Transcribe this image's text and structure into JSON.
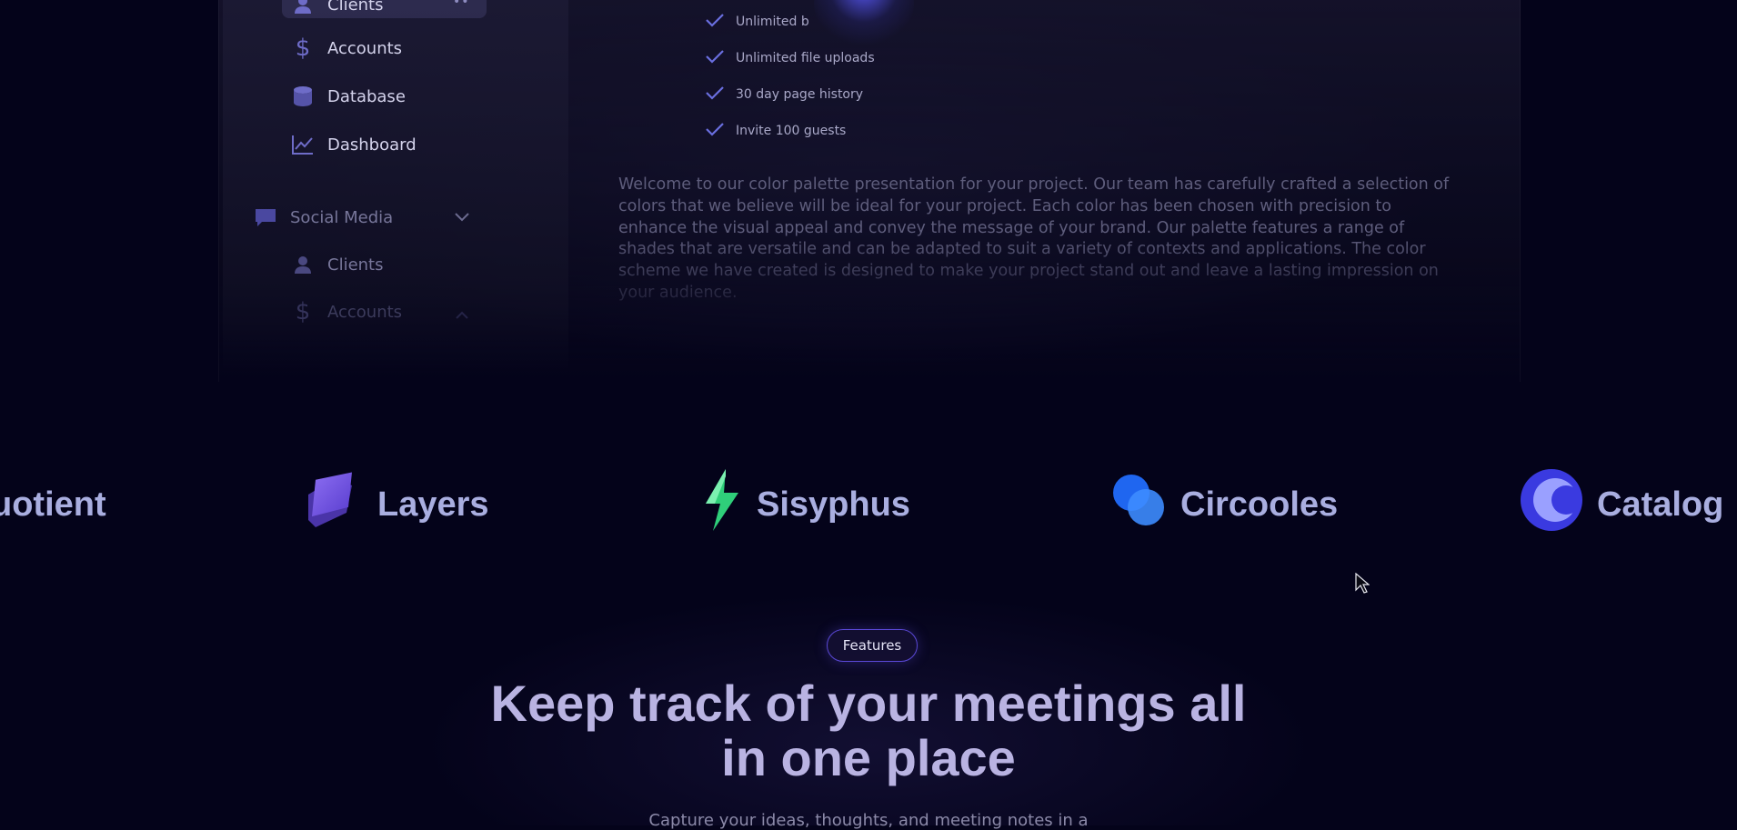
{
  "sidebar": {
    "items": [
      {
        "label": "Clients",
        "icon": "user-icon"
      },
      {
        "label": "Accounts",
        "icon": "dollar-icon"
      },
      {
        "label": "Database",
        "icon": "database-icon"
      },
      {
        "label": "Dashboard",
        "icon": "chart-line-icon"
      }
    ],
    "section": {
      "label": "Social Media",
      "icon": "chat-icon"
    },
    "sub_items": [
      {
        "label": "Clients",
        "icon": "user-icon"
      },
      {
        "label": "Accounts",
        "icon": "dollar-icon"
      }
    ]
  },
  "pricing": {
    "features": [
      "Unlimited b",
      "Unlimited file uploads",
      "30 day page history",
      "Invite 100 guests"
    ]
  },
  "description": "Welcome to our color palette presentation for your project. Our team has carefully crafted a selection of colors that we believe will be ideal for your project. Each color has been chosen with precision to enhance the visual appeal and convey the message of your brand. Our palette features a range of shades that are versatile and can be adapted to suit a variety of contexts and applications. The color scheme we have created is designed to make your project stand out and leave a lasting impression on your audience.",
  "logos": [
    {
      "name": "uotient"
    },
    {
      "name": "Layers"
    },
    {
      "name": "Sisyphus"
    },
    {
      "name": "Circooles"
    },
    {
      "name": "Catalog"
    }
  ],
  "features_section": {
    "badge": "Features",
    "headline_line1": "Keep track of your meetings all",
    "headline_line2": "in one place",
    "subtitle": "Capture your ideas, thoughts, and meeting notes in a"
  },
  "colors": {
    "background": "#04031a",
    "accent": "#5a48d6",
    "check": "#6a6fe0",
    "logo_text": "#a9aee0"
  }
}
